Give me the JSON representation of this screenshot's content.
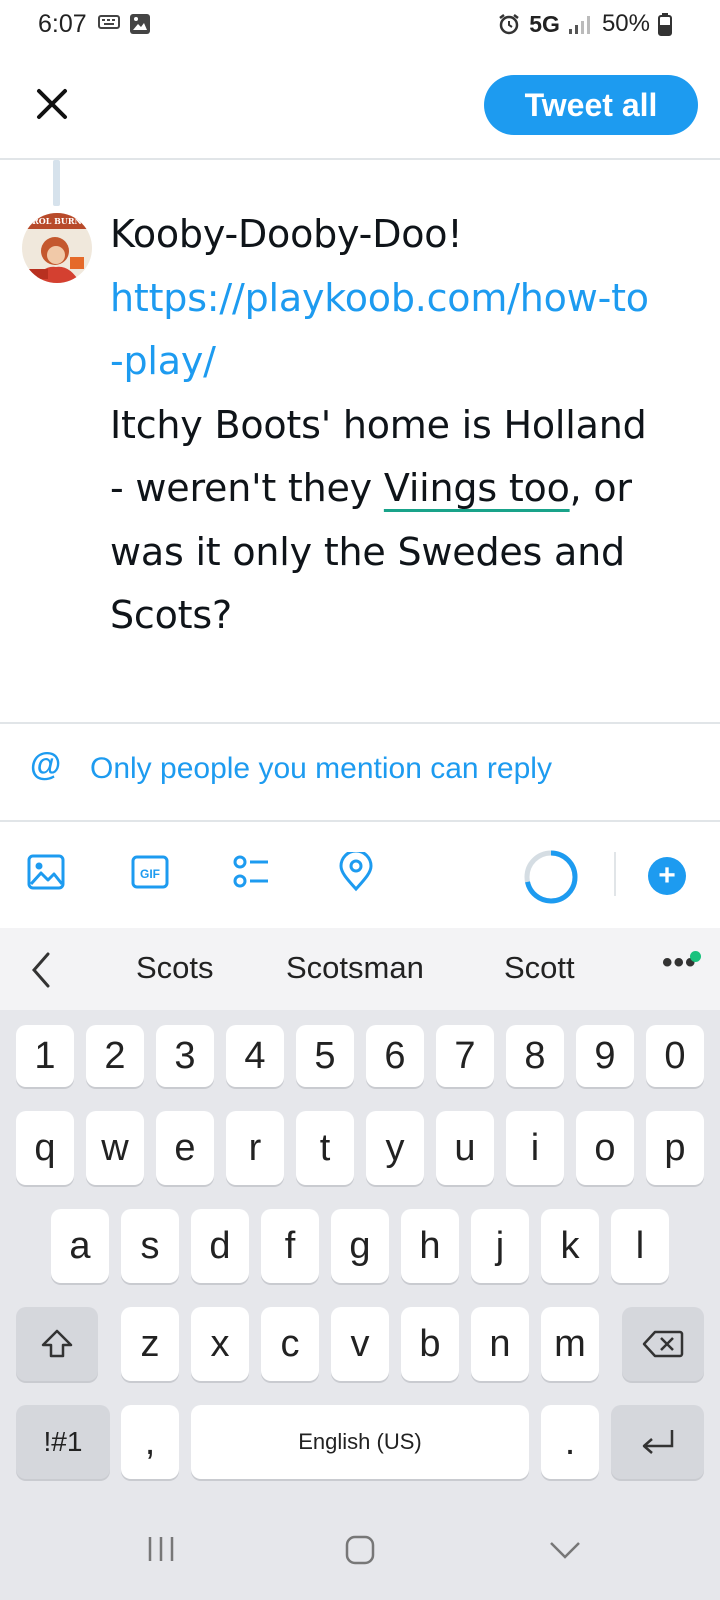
{
  "status_bar": {
    "time": "6:07",
    "network": "5G",
    "battery": "50%"
  },
  "header": {
    "close_icon": "close-icon",
    "tweet_all_label": "Tweet all"
  },
  "compose": {
    "text_lines": [
      "Kooby-Dooby-Doo!",
      "https://playkoob.com/how-to",
      "-play/",
      "Itchy Boots' home is Holland",
      "- weren't they ",
      "Viings too",
      ", or",
      "was it only the Swedes and",
      "Scots?"
    ]
  },
  "reply_setting": {
    "label": "Only people you mention can reply"
  },
  "toolbar": {
    "icons": [
      "image-icon",
      "gif-icon",
      "poll-icon",
      "location-icon"
    ],
    "gif_label": "GIF",
    "add_label": "+"
  },
  "keyboard": {
    "suggestions": [
      "Scots",
      "Scotsman",
      "Scott"
    ],
    "more": "•••",
    "row_numbers": [
      "1",
      "2",
      "3",
      "4",
      "5",
      "6",
      "7",
      "8",
      "9",
      "0"
    ],
    "row1": [
      "q",
      "w",
      "e",
      "r",
      "t",
      "y",
      "u",
      "i",
      "o",
      "p"
    ],
    "row2": [
      "a",
      "s",
      "d",
      "f",
      "g",
      "h",
      "j",
      "k",
      "l"
    ],
    "row3": [
      "z",
      "x",
      "c",
      "v",
      "b",
      "n",
      "m"
    ],
    "symbols_label": "!#1",
    "comma": ",",
    "space_label": "English (US)",
    "period": "."
  },
  "colors": {
    "accent": "#1d9bf0",
    "spell_underline": "#19a38a"
  }
}
